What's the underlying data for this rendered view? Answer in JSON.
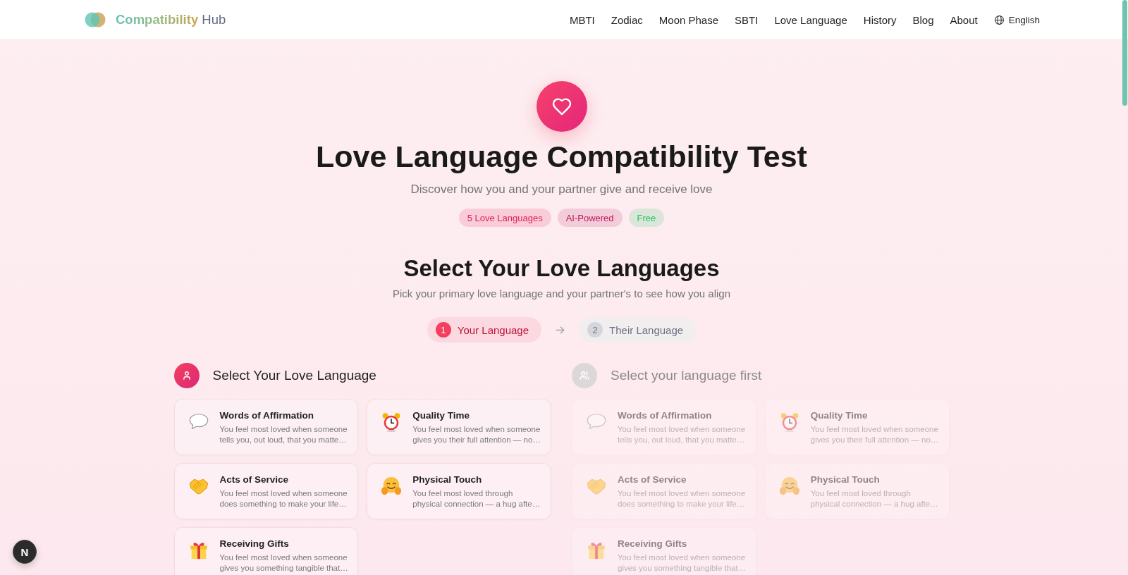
{
  "header": {
    "brand": {
      "name": "Compatibility",
      "suffix": "Hub"
    },
    "nav": [
      {
        "label": "MBTI"
      },
      {
        "label": "Zodiac"
      },
      {
        "label": "Moon Phase"
      },
      {
        "label": "SBTI"
      },
      {
        "label": "Love Language"
      },
      {
        "label": "History"
      },
      {
        "label": "Blog"
      },
      {
        "label": "About"
      }
    ],
    "language": "English"
  },
  "hero": {
    "title": "Love Language Compatibility Test",
    "subtitle": "Discover how you and your partner give and receive love",
    "badges": [
      {
        "label": "5 Love Languages",
        "color": "#e11d55"
      },
      {
        "label": "AI-Powered",
        "color": "#be185d"
      },
      {
        "label": "Free",
        "color": "#22c55e"
      }
    ]
  },
  "section": {
    "title": "Select Your Love Languages",
    "subtitle": "Pick your primary love language and your partner's to see how you align",
    "steps": [
      {
        "number": "1",
        "label": "Your Language",
        "selected": true
      },
      {
        "number": "2",
        "label": "Their Language",
        "selected": false
      }
    ]
  },
  "panels": [
    {
      "heading": "Select Your Love Language",
      "disabled": false,
      "options": [
        {
          "title": "Words of Affirmation",
          "description": "You feel most loved when someone tells you, out loud, that you matte…",
          "selected": false
        },
        {
          "title": "Quality Time",
          "description": "You feel most loved when someone gives you their full attention — no…",
          "selected": false
        },
        {
          "title": "Acts of Service",
          "description": "You feel most loved when someone does something to make your life…",
          "selected": false
        },
        {
          "title": "Physical Touch",
          "description": "You feel most loved through physical connection — a hug afte…",
          "selected": false
        },
        {
          "title": "Receiving Gifts",
          "description": "You feel most loved when someone gives you something tangible that…",
          "selected": false
        }
      ]
    },
    {
      "heading": "Select your language first",
      "disabled": true,
      "options": [
        {
          "title": "Words of Affirmation",
          "description": "You feel most loved when someone tells you, out loud, that you matte…",
          "selected": false
        },
        {
          "title": "Quality Time",
          "description": "You feel most loved when someone gives you their full attention — no…",
          "selected": false
        },
        {
          "title": "Acts of Service",
          "description": "You feel most loved when someone does something to make your life…",
          "selected": false
        },
        {
          "title": "Physical Touch",
          "description": "You feel most loved through physical connection — a hug afte…",
          "selected": false
        },
        {
          "title": "Receiving Gifts",
          "description": "You feel most loved when someone gives you something tangible that…",
          "selected": false
        }
      ]
    }
  ],
  "dev_badge": "N"
}
